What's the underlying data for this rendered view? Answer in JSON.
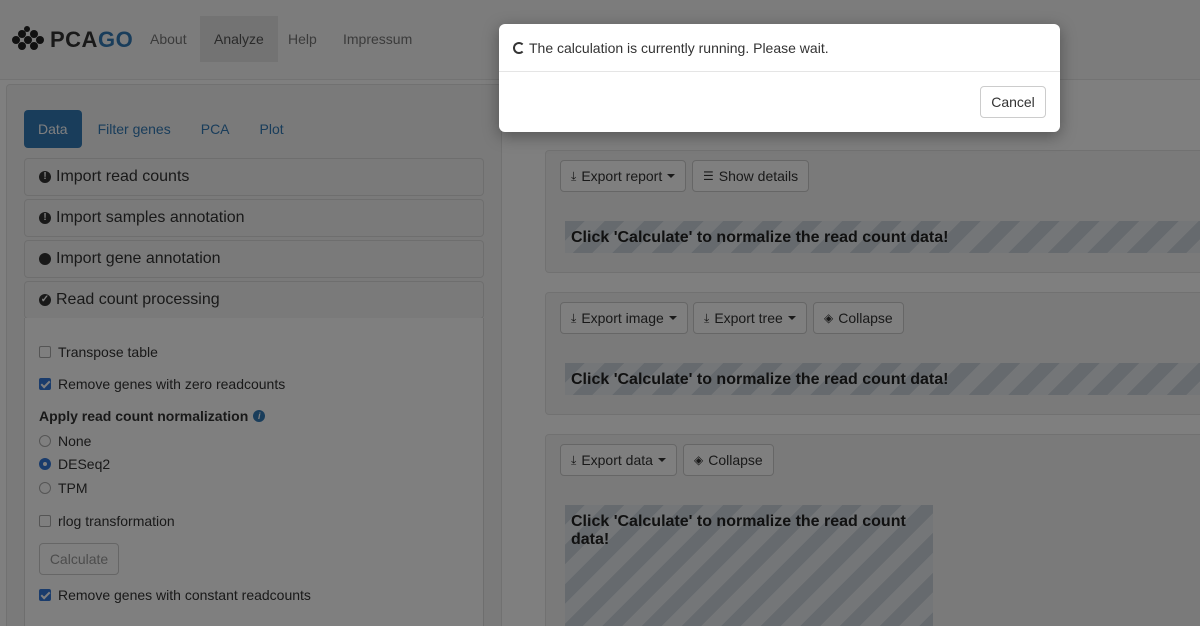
{
  "app": {
    "logo_prefix": "PCA",
    "logo_suffix": "GO"
  },
  "nav": {
    "items": [
      "About",
      "Analyze",
      "Help",
      "Impressum"
    ],
    "active": "Analyze"
  },
  "tabs": [
    "Data",
    "Filter genes",
    "PCA",
    "Plot"
  ],
  "accordion": [
    {
      "label": "Import read counts",
      "icon": "exclamation-circle-icon"
    },
    {
      "label": "Import samples annotation",
      "icon": "exclamation-circle-icon"
    },
    {
      "label": "Import gene annotation",
      "icon": "circle-icon"
    },
    {
      "label": "Read count processing",
      "icon": "check-circle-icon"
    }
  ],
  "processing": {
    "transpose": {
      "label": "Transpose table",
      "checked": false
    },
    "remove_zero": {
      "label": "Remove genes with zero readcounts",
      "checked": true
    },
    "normalization_label": "Apply read count normalization",
    "normalization_options": [
      "None",
      "DESeq2",
      "TPM"
    ],
    "normalization_selected": "DESeq2",
    "rlog": {
      "label": "rlog transformation",
      "checked": false
    },
    "calculate_label": "Calculate",
    "remove_constant": {
      "label": "Remove genes with constant readcounts",
      "checked": true
    }
  },
  "panels": {
    "p1": {
      "export_label": "Export report",
      "details_label": "Show details",
      "message": "Click 'Calculate' to normalize the read count data!"
    },
    "p2": {
      "export_image_label": "Export image",
      "export_tree_label": "Export tree",
      "collapse_label": "Collapse",
      "message": "Click 'Calculate' to normalize the read count data!"
    },
    "p3": {
      "export_data_label": "Export data",
      "collapse_label": "Collapse",
      "message": "Click 'Calculate' to normalize the read count data!"
    }
  },
  "modal": {
    "message": "The calculation is currently running. Please wait.",
    "cancel_label": "Cancel"
  },
  "colors": {
    "primary": "#337ab7",
    "checkbox": "#3478d9",
    "overlay": "rgba(0,0,0,0.5)"
  }
}
